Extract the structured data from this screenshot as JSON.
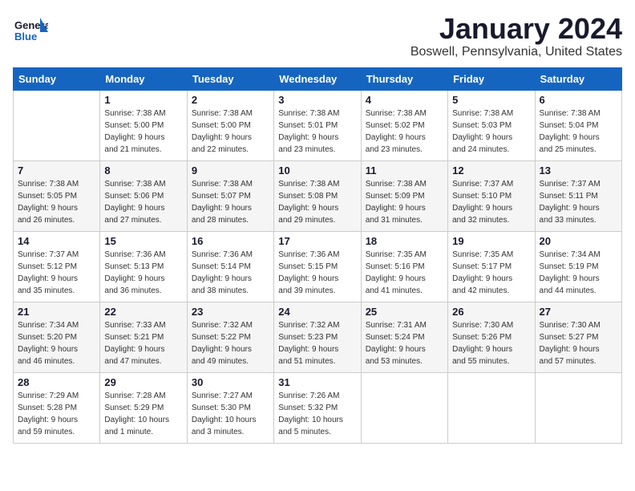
{
  "header": {
    "logo_general": "General",
    "logo_blue": "Blue",
    "title": "January 2024",
    "subtitle": "Boswell, Pennsylvania, United States"
  },
  "days_of_week": [
    "Sunday",
    "Monday",
    "Tuesday",
    "Wednesday",
    "Thursday",
    "Friday",
    "Saturday"
  ],
  "weeks": [
    [
      {
        "day": "",
        "info": ""
      },
      {
        "day": "1",
        "info": "Sunrise: 7:38 AM\nSunset: 5:00 PM\nDaylight: 9 hours\nand 21 minutes."
      },
      {
        "day": "2",
        "info": "Sunrise: 7:38 AM\nSunset: 5:00 PM\nDaylight: 9 hours\nand 22 minutes."
      },
      {
        "day": "3",
        "info": "Sunrise: 7:38 AM\nSunset: 5:01 PM\nDaylight: 9 hours\nand 23 minutes."
      },
      {
        "day": "4",
        "info": "Sunrise: 7:38 AM\nSunset: 5:02 PM\nDaylight: 9 hours\nand 23 minutes."
      },
      {
        "day": "5",
        "info": "Sunrise: 7:38 AM\nSunset: 5:03 PM\nDaylight: 9 hours\nand 24 minutes."
      },
      {
        "day": "6",
        "info": "Sunrise: 7:38 AM\nSunset: 5:04 PM\nDaylight: 9 hours\nand 25 minutes."
      }
    ],
    [
      {
        "day": "7",
        "info": "Sunrise: 7:38 AM\nSunset: 5:05 PM\nDaylight: 9 hours\nand 26 minutes."
      },
      {
        "day": "8",
        "info": "Sunrise: 7:38 AM\nSunset: 5:06 PM\nDaylight: 9 hours\nand 27 minutes."
      },
      {
        "day": "9",
        "info": "Sunrise: 7:38 AM\nSunset: 5:07 PM\nDaylight: 9 hours\nand 28 minutes."
      },
      {
        "day": "10",
        "info": "Sunrise: 7:38 AM\nSunset: 5:08 PM\nDaylight: 9 hours\nand 29 minutes."
      },
      {
        "day": "11",
        "info": "Sunrise: 7:38 AM\nSunset: 5:09 PM\nDaylight: 9 hours\nand 31 minutes."
      },
      {
        "day": "12",
        "info": "Sunrise: 7:37 AM\nSunset: 5:10 PM\nDaylight: 9 hours\nand 32 minutes."
      },
      {
        "day": "13",
        "info": "Sunrise: 7:37 AM\nSunset: 5:11 PM\nDaylight: 9 hours\nand 33 minutes."
      }
    ],
    [
      {
        "day": "14",
        "info": "Sunrise: 7:37 AM\nSunset: 5:12 PM\nDaylight: 9 hours\nand 35 minutes."
      },
      {
        "day": "15",
        "info": "Sunrise: 7:36 AM\nSunset: 5:13 PM\nDaylight: 9 hours\nand 36 minutes."
      },
      {
        "day": "16",
        "info": "Sunrise: 7:36 AM\nSunset: 5:14 PM\nDaylight: 9 hours\nand 38 minutes."
      },
      {
        "day": "17",
        "info": "Sunrise: 7:36 AM\nSunset: 5:15 PM\nDaylight: 9 hours\nand 39 minutes."
      },
      {
        "day": "18",
        "info": "Sunrise: 7:35 AM\nSunset: 5:16 PM\nDaylight: 9 hours\nand 41 minutes."
      },
      {
        "day": "19",
        "info": "Sunrise: 7:35 AM\nSunset: 5:17 PM\nDaylight: 9 hours\nand 42 minutes."
      },
      {
        "day": "20",
        "info": "Sunrise: 7:34 AM\nSunset: 5:19 PM\nDaylight: 9 hours\nand 44 minutes."
      }
    ],
    [
      {
        "day": "21",
        "info": "Sunrise: 7:34 AM\nSunset: 5:20 PM\nDaylight: 9 hours\nand 46 minutes."
      },
      {
        "day": "22",
        "info": "Sunrise: 7:33 AM\nSunset: 5:21 PM\nDaylight: 9 hours\nand 47 minutes."
      },
      {
        "day": "23",
        "info": "Sunrise: 7:32 AM\nSunset: 5:22 PM\nDaylight: 9 hours\nand 49 minutes."
      },
      {
        "day": "24",
        "info": "Sunrise: 7:32 AM\nSunset: 5:23 PM\nDaylight: 9 hours\nand 51 minutes."
      },
      {
        "day": "25",
        "info": "Sunrise: 7:31 AM\nSunset: 5:24 PM\nDaylight: 9 hours\nand 53 minutes."
      },
      {
        "day": "26",
        "info": "Sunrise: 7:30 AM\nSunset: 5:26 PM\nDaylight: 9 hours\nand 55 minutes."
      },
      {
        "day": "27",
        "info": "Sunrise: 7:30 AM\nSunset: 5:27 PM\nDaylight: 9 hours\nand 57 minutes."
      }
    ],
    [
      {
        "day": "28",
        "info": "Sunrise: 7:29 AM\nSunset: 5:28 PM\nDaylight: 9 hours\nand 59 minutes."
      },
      {
        "day": "29",
        "info": "Sunrise: 7:28 AM\nSunset: 5:29 PM\nDaylight: 10 hours\nand 1 minute."
      },
      {
        "day": "30",
        "info": "Sunrise: 7:27 AM\nSunset: 5:30 PM\nDaylight: 10 hours\nand 3 minutes."
      },
      {
        "day": "31",
        "info": "Sunrise: 7:26 AM\nSunset: 5:32 PM\nDaylight: 10 hours\nand 5 minutes."
      },
      {
        "day": "",
        "info": ""
      },
      {
        "day": "",
        "info": ""
      },
      {
        "day": "",
        "info": ""
      }
    ]
  ]
}
